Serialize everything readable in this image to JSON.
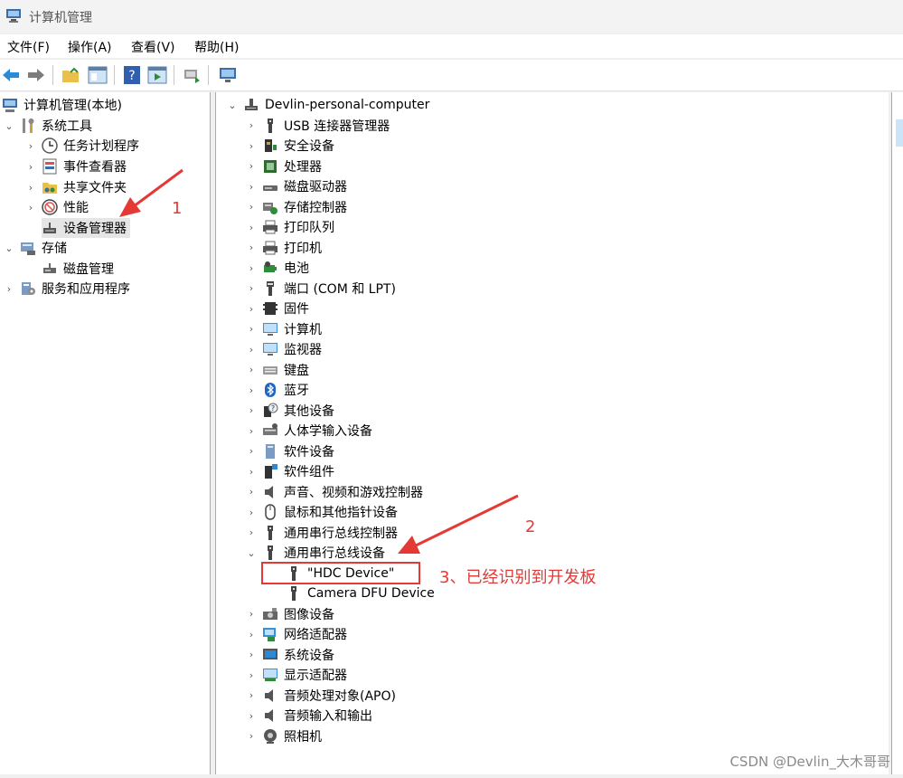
{
  "window": {
    "title": "计算机管理"
  },
  "menu": [
    {
      "label": "文件(F)"
    },
    {
      "label": "操作(A)"
    },
    {
      "label": "查看(V)"
    },
    {
      "label": "帮助(H)"
    }
  ],
  "left_tree": [
    {
      "label": "计算机管理(本地)",
      "icon": "computer-management-icon"
    },
    {
      "label": "系统工具",
      "icon": "tools-icon"
    },
    {
      "label": "任务计划程序",
      "icon": "clock-icon"
    },
    {
      "label": "事件查看器",
      "icon": "event-viewer-icon"
    },
    {
      "label": "共享文件夹",
      "icon": "shared-folder-icon"
    },
    {
      "label": "性能",
      "icon": "performance-icon"
    },
    {
      "label": "设备管理器",
      "icon": "device-manager-icon"
    },
    {
      "label": "存储",
      "icon": "storage-icon"
    },
    {
      "label": "磁盘管理",
      "icon": "disk-management-icon"
    },
    {
      "label": "服务和应用程序",
      "icon": "services-icon"
    }
  ],
  "device_tree": [
    {
      "label": "Devlin-personal-computer",
      "icon": "computer-icon"
    },
    {
      "label": "USB 连接器管理器",
      "icon": "usb-icon"
    },
    {
      "label": "安全设备",
      "icon": "security-device-icon"
    },
    {
      "label": "处理器",
      "icon": "processor-icon"
    },
    {
      "label": "磁盘驱动器",
      "icon": "disk-drive-icon"
    },
    {
      "label": "存储控制器",
      "icon": "storage-controller-icon"
    },
    {
      "label": "打印队列",
      "icon": "printer-icon"
    },
    {
      "label": "打印机",
      "icon": "printer-icon"
    },
    {
      "label": "电池",
      "icon": "battery-icon"
    },
    {
      "label": "端口 (COM 和 LPT)",
      "icon": "port-icon"
    },
    {
      "label": "固件",
      "icon": "firmware-icon"
    },
    {
      "label": "计算机",
      "icon": "monitor-icon"
    },
    {
      "label": "监视器",
      "icon": "monitor-icon"
    },
    {
      "label": "键盘",
      "icon": "keyboard-icon"
    },
    {
      "label": "蓝牙",
      "icon": "bluetooth-icon"
    },
    {
      "label": "其他设备",
      "icon": "other-device-icon"
    },
    {
      "label": "人体学输入设备",
      "icon": "hid-icon"
    },
    {
      "label": "软件设备",
      "icon": "software-device-icon"
    },
    {
      "label": "软件组件",
      "icon": "software-component-icon"
    },
    {
      "label": "声音、视频和游戏控制器",
      "icon": "speaker-icon"
    },
    {
      "label": "鼠标和其他指针设备",
      "icon": "mouse-icon"
    },
    {
      "label": "通用串行总线控制器",
      "icon": "usb-icon"
    },
    {
      "label": "通用串行总线设备",
      "icon": "usb-icon"
    },
    {
      "label": "\"HDC Device\"",
      "icon": "usb-icon"
    },
    {
      "label": "Camera DFU Device",
      "icon": "usb-icon"
    },
    {
      "label": "图像设备",
      "icon": "camera-device-icon"
    },
    {
      "label": "网络适配器",
      "icon": "network-adapter-icon"
    },
    {
      "label": "系统设备",
      "icon": "system-device-icon"
    },
    {
      "label": "显示适配器",
      "icon": "display-adapter-icon"
    },
    {
      "label": "音频处理对象(APO)",
      "icon": "speaker-icon"
    },
    {
      "label": "音频输入和输出",
      "icon": "speaker-icon"
    },
    {
      "label": "照相机",
      "icon": "webcam-icon"
    }
  ],
  "annotations": {
    "step1": "1",
    "step2": "2",
    "step3": "3、已经识别到开发板",
    "color": "#e53935"
  },
  "watermark": "CSDN @Devlin_大木哥哥"
}
